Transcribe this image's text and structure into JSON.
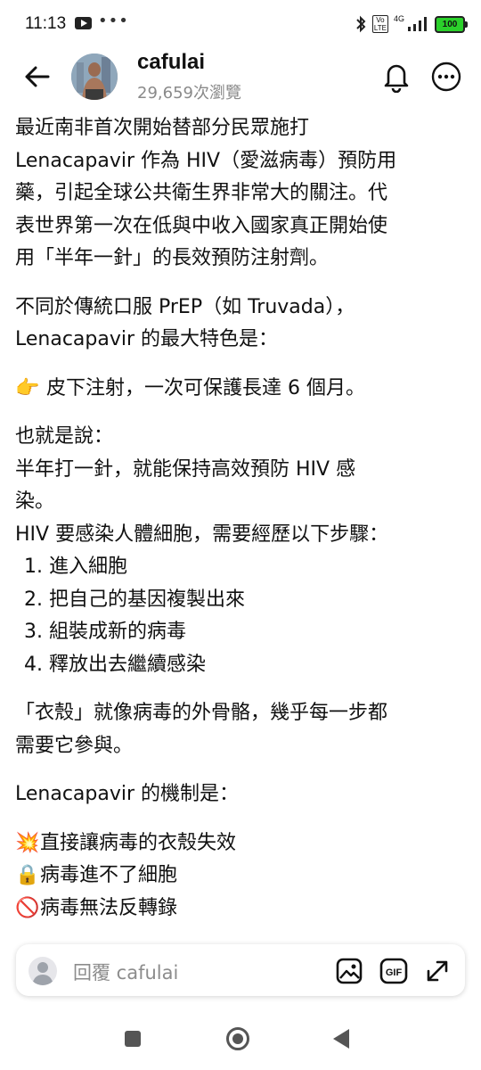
{
  "status_bar": {
    "time": "11:13",
    "overflow": "•••",
    "volte": "Vo\nLTE",
    "network": "4G",
    "battery": "100"
  },
  "header": {
    "username": "cafulai",
    "views": "29,659次瀏覽"
  },
  "post": {
    "p1": [
      "最近南非首次開始替部分民眾施打",
      "Lenacapavir 作為 HIV（愛滋病毒）預防用",
      "藥，引起全球公共衛生界非常大的關注。代",
      "表世界第一次在低與中收入國家真正開始使",
      "用「半年一針」的長效預防注射劑。"
    ],
    "p2": [
      "不同於傳統口服 PrEP（如 Truvada），",
      "Lenacapavir 的最大特色是："
    ],
    "p3": {
      "emoji": "👉",
      "text": "皮下注射，一次可保護長達 6 個月。"
    },
    "p4": [
      "也就是說：",
      "半年打一針，就能保持高效預防 HIV 感",
      "染。",
      "HIV 要感染人體細胞，需要經歷以下步驟："
    ],
    "steps": [
      "1. 進入細胞",
      "2. 把自己的基因複製出來",
      "3. 組裝成新的病毒",
      "4. 釋放出去繼續感染"
    ],
    "p5": [
      "「衣殼」就像病毒的外骨骼，幾乎每一步都",
      "需要它參與。"
    ],
    "p6": "Lenacapavir 的機制是：",
    "mechanisms": [
      {
        "emoji": "💥",
        "text": "直接讓病毒的衣殼失效"
      },
      {
        "emoji": "🔒",
        "text": "病毒進不了細胞"
      },
      {
        "emoji": "🚫",
        "text": "病毒無法反轉錄"
      }
    ]
  },
  "reply": {
    "placeholder": "回覆 cafulai",
    "gif_label": "GIF"
  }
}
